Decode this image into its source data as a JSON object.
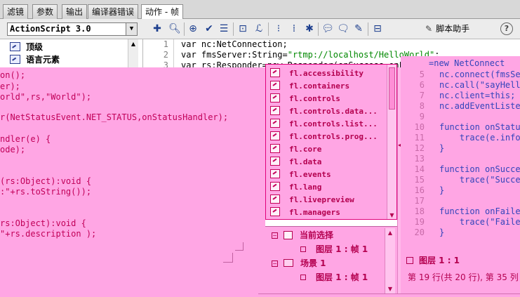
{
  "tabs": [
    "滤镜",
    "参数",
    "输出",
    "编译器错误",
    "动作 - 帧"
  ],
  "toolbar": {
    "language_select": "ActionScript 3.0",
    "assistant_label": "脚本助手",
    "help_glyph": "?",
    "icons": [
      "add-statement-icon",
      "find-icon",
      "target-icon",
      "check-syntax-icon",
      "auto-format-icon",
      "code-hint-icon",
      "debug-options-icon",
      "collapse-braces-icon",
      "collapse-selection-icon",
      "expand-all-icon",
      "apply-block-comment-icon",
      "apply-line-comment-icon",
      "remove-comment-icon",
      "show-hide-toolbox-icon"
    ]
  },
  "toolbox": {
    "items": [
      {
        "label": "顶级",
        "icon": "book-icon"
      },
      {
        "label": "语言元素",
        "icon": "book-icon"
      }
    ]
  },
  "code_top": [
    {
      "n": "1",
      "text": "var nc:NetConnection;"
    },
    {
      "n": "2",
      "pre": "var fmsServer:String=",
      "str": "\"rtmp://localhost/HelloWorld\"",
      "post": ";"
    },
    {
      "n": "3",
      "text": "var rs:Responder=new Responder(onSuccess,onFai"
    }
  ],
  "code_left": [
    "on();",
    "er);",
    "orld\",rs,\"World\");",
    "r(NetStatusEvent.NET_STATUS,onStatusHandler);",
    "ndler(e) {",
    "ode);",
    "(rs:Object):void {",
    ":\"+rs.toString());",
    "rs:Object):void {",
    "\"+rs.description );"
  ],
  "code_hints": [
    "fl.accessibility",
    "fl.containers",
    "fl.controls",
    "fl.controls.data...",
    "fl.controls.list...",
    "fl.controls.prog...",
    "fl.core",
    "fl.data",
    "fl.events",
    "fl.lang",
    "fl.livepreview",
    "fl.managers"
  ],
  "navigator": {
    "current_selection": "当前选择",
    "current_frame": "图层 1 : 帧 1",
    "scene": "场景 1",
    "scene_frame": "图层 1 : 帧 1"
  },
  "code_right": [
    {
      "n": "",
      "text": "=new NetConnect"
    },
    {
      "n": "5",
      "text": "nc.connect(fmsSe"
    },
    {
      "n": "6",
      "text": "nc.call(\"sayHelle"
    },
    {
      "n": "7",
      "text": "nc.client=this;"
    },
    {
      "n": "8",
      "text": "nc.addEventListe"
    },
    {
      "n": "9",
      "text": ""
    },
    {
      "n": "10",
      "text": "function onStatu"
    },
    {
      "n": "11",
      "text": "    trace(e.info."
    },
    {
      "n": "12",
      "text": "}"
    },
    {
      "n": "13",
      "text": ""
    },
    {
      "n": "14",
      "text": "function onSucce"
    },
    {
      "n": "15",
      "text": "    trace(\"Succes"
    },
    {
      "n": "16",
      "text": "}"
    },
    {
      "n": "17",
      "text": ""
    },
    {
      "n": "18",
      "text": "function onFailed"
    },
    {
      "n": "19",
      "text": "    trace(\"Failed"
    },
    {
      "n": "20",
      "text": "}"
    }
  ],
  "status": {
    "tab_label": "图层 1 : 1",
    "line_info": "第 19 行(共 20 行), 第 35 列"
  }
}
